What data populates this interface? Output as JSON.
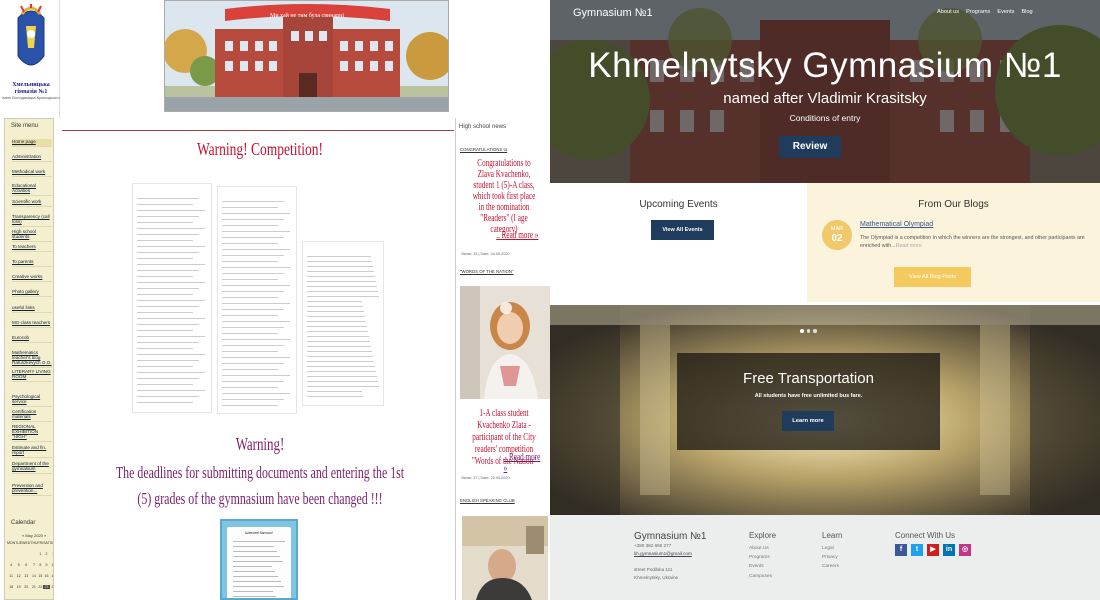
{
  "left": {
    "logo": {
      "title": "Хмельницька гімназія №1",
      "subtitle": "імені Володимира Красицького"
    },
    "banner": {
      "ribbon": "Ми хай не тим була свинарні"
    },
    "sidebar": {
      "title": "Site menu",
      "items": [
        "Home page",
        "Administration",
        "Methodical work",
        "Educational Activities",
        "Scientific work",
        "Transparency (call loss)",
        "High school students",
        "To teachers",
        "To parents",
        "Creative works",
        "Photo gallery",
        "useful links",
        "MO class teachers",
        "Eurocob",
        "Mathematics teacher's blog Rafuszkevych O.O.",
        "LITERARY LIVING ROOM",
        "Psychological service",
        "Certification materials",
        "REGIONAL EXHIBITION \"HIGH\"",
        "Estimate and fin. report",
        "Department of the gymnasium",
        "Prevention and prevention..."
      ],
      "calendar": {
        "title": "Calendar",
        "month": "« May 2020 »",
        "weekdays": [
          "MON",
          "TUE",
          "WED",
          "THU",
          "FRI",
          "SAT",
          "SUN"
        ],
        "days": [
          "",
          "",
          "",
          "",
          "1",
          "2",
          "3",
          "4",
          "5",
          "6",
          "7",
          "8",
          "9",
          "10",
          "11",
          "12",
          "13",
          "14",
          "15",
          "16",
          "17",
          "18",
          "19",
          "20",
          "21",
          "22",
          "23",
          "24"
        ],
        "selected": "23"
      }
    },
    "warning1": "Warning! Competition!",
    "warning2": "Warning!",
    "warning3": "The deadlines for submitting documents and entering the 1st (5) grades of the gymnasium have been changed !!!",
    "poster_title": "Шановні батьки!",
    "news": {
      "heading": "High school news",
      "cat1": "CONGRATULATIONS to",
      "item1": "Congratulations to Zlava Kvachenko, student 1 (5)-A class, which took first place in the nomination \"Readers\" (I age category)",
      "item1_more": ".. Read more »",
      "date1": "Views: 33 | Date: 04.05.2020",
      "cat2": "\"WORDS OF THE NATION\"",
      "item2": "1-A class student Kvachenko Zlata - participant of the City readers' competition \"Words of the Nation\"",
      "item2_more": ".. Read more »",
      "date2": "Views: 37 | Date: 20.04.2020",
      "cat3": "ENGLISH SPEAKING CLUB"
    }
  },
  "right": {
    "nav": {
      "brand": "Gymnasium №1",
      "links": [
        "About us",
        "Programs",
        "Events",
        "Blog"
      ]
    },
    "hero": {
      "title": "Khmelnytsky Gymnasium №1",
      "subtitle": "named after Vladimir Krasitsky",
      "conditions": "Conditions of entry",
      "button": "Review"
    },
    "events": {
      "title": "Upcoming Events",
      "button": "View All Events"
    },
    "blogs": {
      "title": "From Our Blogs",
      "badge_month": "MAR",
      "badge_day": "02",
      "post_title": "Mathematical Olympiad",
      "post_text": "The Olympiad is a competition in which the winners are the strongest, and other participants are enriched with...",
      "read_more": "Read more",
      "button": "View All Blog Posts"
    },
    "slider": {
      "title": "Free Transportation",
      "subtitle": "All students have free unlimited bus fare.",
      "button": "Learn more"
    },
    "footer": {
      "brand": "Gymnasium №1",
      "phone": "+380 382 656 277",
      "email": "kh.gymnasium1@gmail.com",
      "address1": "street Podilska 111",
      "address2": "Khmelnytsky, Ukraine",
      "explore_title": "Explore",
      "explore": [
        "About Us",
        "Programs",
        "Events",
        "Campuses"
      ],
      "learn_title": "Learn",
      "learn": [
        "Legal",
        "Privacy",
        "Careers"
      ],
      "connect_title": "Connect With Us",
      "social": [
        {
          "icon": "facebook-icon",
          "glyph": "f",
          "color": "#3b5998"
        },
        {
          "icon": "twitter-icon",
          "glyph": "t",
          "color": "#1da1f2"
        },
        {
          "icon": "youtube-icon",
          "glyph": "▶",
          "color": "#cd201f"
        },
        {
          "icon": "linkedin-icon",
          "glyph": "in",
          "color": "#0077b5"
        },
        {
          "icon": "instagram-icon",
          "glyph": "◎",
          "color": "#c13584"
        }
      ]
    }
  }
}
